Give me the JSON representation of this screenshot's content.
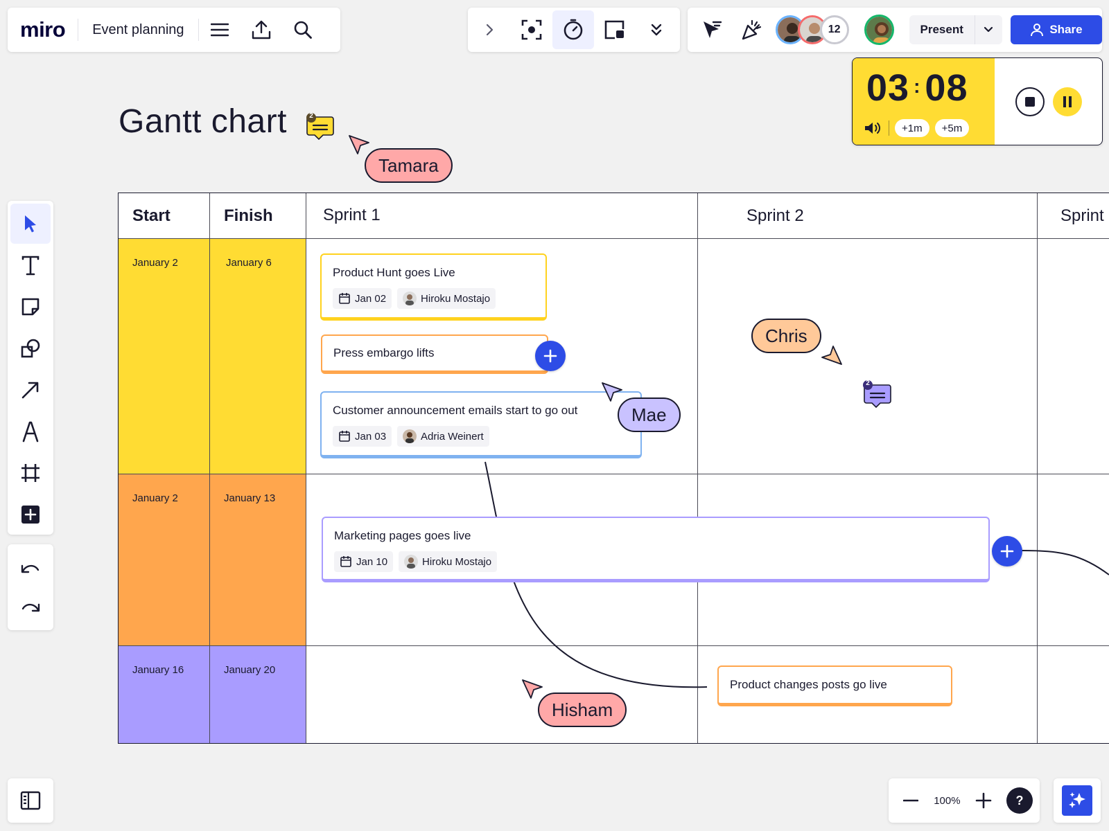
{
  "app": {
    "logo": "miro",
    "board_name": "Event planning"
  },
  "collab": {
    "avatar_count": "12",
    "present_label": "Present",
    "share_label": "Share"
  },
  "timer": {
    "minutes": "03",
    "colon": ":",
    "seconds": "08",
    "add_1m": "+1m",
    "add_5m": "+5m"
  },
  "title": "Gantt chart",
  "title_comment_count": "2",
  "table": {
    "headers": {
      "start": "Start",
      "finish": "Finish",
      "sprint1": "Sprint 1",
      "sprint2": "Sprint 2",
      "sprint3": "Sprint"
    },
    "rows": [
      {
        "start": "January 2",
        "finish": "January 6",
        "color": "#ffdc33"
      },
      {
        "start": "January 2",
        "finish": "January 13",
        "color": "#ffa64d"
      },
      {
        "start": "January 16",
        "finish": "January 20",
        "color": "#a99cff"
      }
    ]
  },
  "cards": [
    {
      "title": "Product Hunt goes Live",
      "date": "Jan 02",
      "assignee": "Hiroku Mostajo",
      "color": "#ffd21e"
    },
    {
      "title": "Press embargo lifts",
      "color": "#ffa64d"
    },
    {
      "title": "Customer announcement emails start to go out",
      "date": "Jan 03",
      "assignee": "Adria Weinert",
      "color": "#7fb2f0"
    },
    {
      "title": "Marketing pages goes live",
      "date": "Jan 10",
      "assignee": "Hiroku Mostajo",
      "color": "#a99cff"
    },
    {
      "title": "Product changes posts go live",
      "color": "#ffa64d"
    }
  ],
  "cursors": [
    {
      "name": "Tamara",
      "color": "#ffa8a8"
    },
    {
      "name": "Chris",
      "color": "#ffc999"
    },
    {
      "name": "Mae",
      "color": "#c9c2ff"
    },
    {
      "name": "Hisham",
      "color": "#ffa8a8"
    }
  ],
  "comment_sprint2_count": "2",
  "zoom": {
    "level": "100%",
    "help": "?"
  },
  "colors": {
    "accent": "#2d4ce6",
    "timer_bg": "#ffdc33"
  },
  "icons": [
    "menu-icon",
    "export-icon",
    "search-icon",
    "chevron-right-icon",
    "focus-icon",
    "timer-icon",
    "frame-card-icon",
    "chevron-double-down-icon",
    "cursor-filter-icon",
    "celebrate-icon",
    "user-icon",
    "select-icon",
    "text-icon",
    "sticky-note-icon",
    "shapes-icon",
    "arrow-line-icon",
    "pen-icon",
    "frame-icon",
    "add-icon",
    "undo-icon",
    "redo-icon",
    "sidebar-toggle-icon",
    "zoom-out-icon",
    "zoom-in-icon",
    "ai-sparkle-icon",
    "calendar-icon",
    "comment-icon",
    "volume-icon",
    "stop-icon",
    "pause-icon",
    "plus-icon"
  ]
}
